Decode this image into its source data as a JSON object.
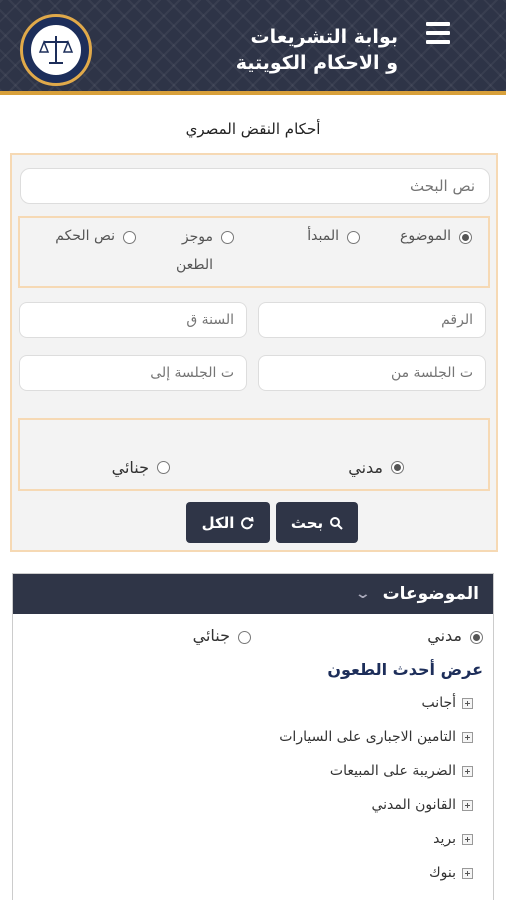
{
  "header": {
    "title_line1": "بوابة التشريعات",
    "title_line2": "و الاحكام الكويتية",
    "menu_icon": "hamburger-menu-icon",
    "logo": "scales-of-justice-logo"
  },
  "page_title": "أحكام النقض المصري",
  "search": {
    "text_placeholder": "نص البحث",
    "type_options": [
      {
        "label": "الموضوع",
        "selected": true
      },
      {
        "label": "المبدأ",
        "selected": false
      },
      {
        "label": "موجز الطعن",
        "selected": false
      },
      {
        "label": "نص الحكم",
        "selected": false
      }
    ],
    "number_placeholder": "الرقم",
    "year_placeholder": "السنة ق",
    "date_from_placeholder": "ت الجلسة من",
    "date_to_placeholder": "ت الجلسة إلى",
    "court_options": [
      {
        "label": "مدني",
        "selected": true
      },
      {
        "label": "جنائي",
        "selected": false
      }
    ],
    "search_button": "بحث",
    "all_button": "الكل"
  },
  "topics": {
    "title": "الموضوعات",
    "court_options": [
      {
        "label": "مدني",
        "selected": true
      },
      {
        "label": "جنائي",
        "selected": false
      }
    ],
    "latest_link": "عرض أحدث الطعون",
    "items": [
      "أجانب",
      "التامين الاجبارى على السيارات",
      "الضريبة على المبيعات",
      "القانون المدني",
      "بريد",
      "بنوك"
    ]
  },
  "colors": {
    "header_bg": "#2e3447",
    "accent": "#d8a03a",
    "panel_border": "#f6d9b4",
    "button_bg": "#2f3547"
  }
}
